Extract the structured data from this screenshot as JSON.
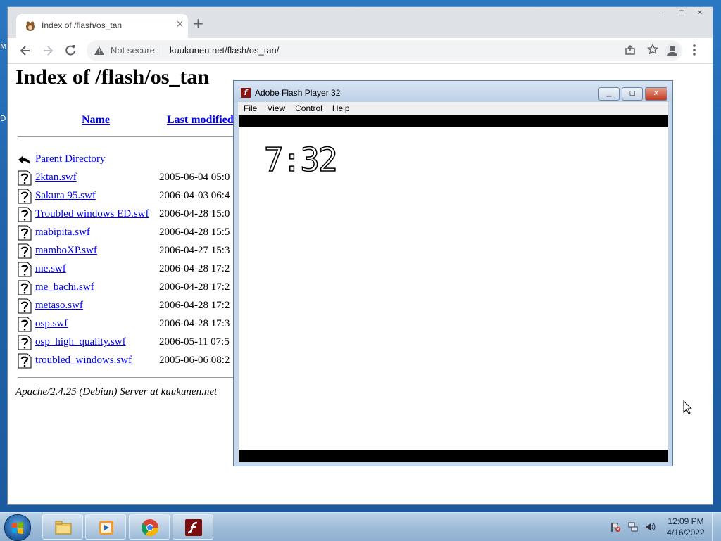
{
  "desktop": {
    "side_letters": [
      "M",
      "D"
    ]
  },
  "browser": {
    "tab_title": "Index of /flash/os_tan",
    "tab_close": "×",
    "new_tab": "+",
    "security_label": "Not secure",
    "url": "kuukunen.net/flash/os_tan/",
    "window_buttons": [
      "–",
      "□",
      "✕"
    ]
  },
  "page": {
    "heading": "Index of /flash/os_tan",
    "columns": {
      "name": "Name",
      "last_modified": "Last modified"
    },
    "parent": "Parent Directory",
    "files": [
      {
        "name": "2ktan.swf",
        "date": "2005-06-04 05:0"
      },
      {
        "name": "Sakura 95.swf",
        "date": "2006-04-03 06:4"
      },
      {
        "name": "Troubled windows ED.swf",
        "date": "2006-04-28 15:0"
      },
      {
        "name": "mabipita.swf",
        "date": "2006-04-28 15:5"
      },
      {
        "name": "mamboXP.swf",
        "date": "2006-04-27 15:3"
      },
      {
        "name": "me.swf",
        "date": "2006-04-28 17:2"
      },
      {
        "name": "me_bachi.swf",
        "date": "2006-04-28 17:2"
      },
      {
        "name": "metaso.swf",
        "date": "2006-04-28 17:2"
      },
      {
        "name": "osp.swf",
        "date": "2006-04-28 17:3"
      },
      {
        "name": "osp_high_quality.swf",
        "date": "2006-05-11 07:5"
      },
      {
        "name": "troubled_windows.swf",
        "date": "2005-06-06 08:2"
      }
    ],
    "server_signature": "Apache/2.4.25 (Debian) Server at kuukunen.net"
  },
  "flash": {
    "title": "Adobe Flash Player 32",
    "icon_letter": "f",
    "menu": [
      "File",
      "View",
      "Control",
      "Help"
    ],
    "clock": "7:32",
    "buttons": [
      "▁",
      "□",
      "✕"
    ]
  },
  "taskbar": {
    "time": "12:09 PM",
    "date": "4/16/2022"
  }
}
